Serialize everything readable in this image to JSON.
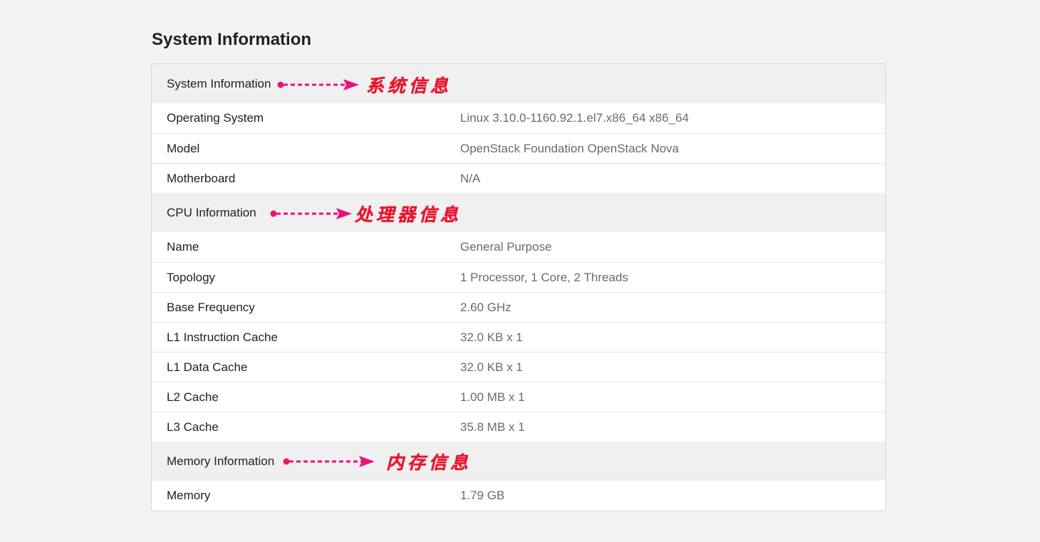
{
  "page": {
    "title": "System Information"
  },
  "sections": {
    "system": {
      "title": "System Information",
      "annotation": "系统信息",
      "rows": [
        {
          "label": "Operating System",
          "value": "Linux 3.10.0-1160.92.1.el7.x86_64 x86_64"
        },
        {
          "label": "Model",
          "value": "OpenStack Foundation OpenStack Nova"
        },
        {
          "label": "Motherboard",
          "value": "N/A"
        }
      ]
    },
    "cpu": {
      "title": "CPU Information",
      "annotation": "处理器信息",
      "rows": [
        {
          "label": "Name",
          "value": "General Purpose"
        },
        {
          "label": "Topology",
          "value": "1 Processor, 1 Core, 2 Threads"
        },
        {
          "label": "Base Frequency",
          "value": "2.60 GHz"
        },
        {
          "label": "L1 Instruction Cache",
          "value": "32.0 KB x 1"
        },
        {
          "label": "L1 Data Cache",
          "value": "32.0 KB x 1"
        },
        {
          "label": "L2 Cache",
          "value": "1.00 MB x 1"
        },
        {
          "label": "L3 Cache",
          "value": "35.8 MB x 1"
        }
      ]
    },
    "memory": {
      "title": "Memory Information",
      "annotation": "内存信息",
      "rows": [
        {
          "label": "Memory",
          "value": "1.79 GB"
        }
      ]
    }
  },
  "colors": {
    "annotation": "#e8132c",
    "arrow": "#e6157a",
    "header_bg": "#f0f0f0",
    "page_bg": "#f3f3f3"
  }
}
